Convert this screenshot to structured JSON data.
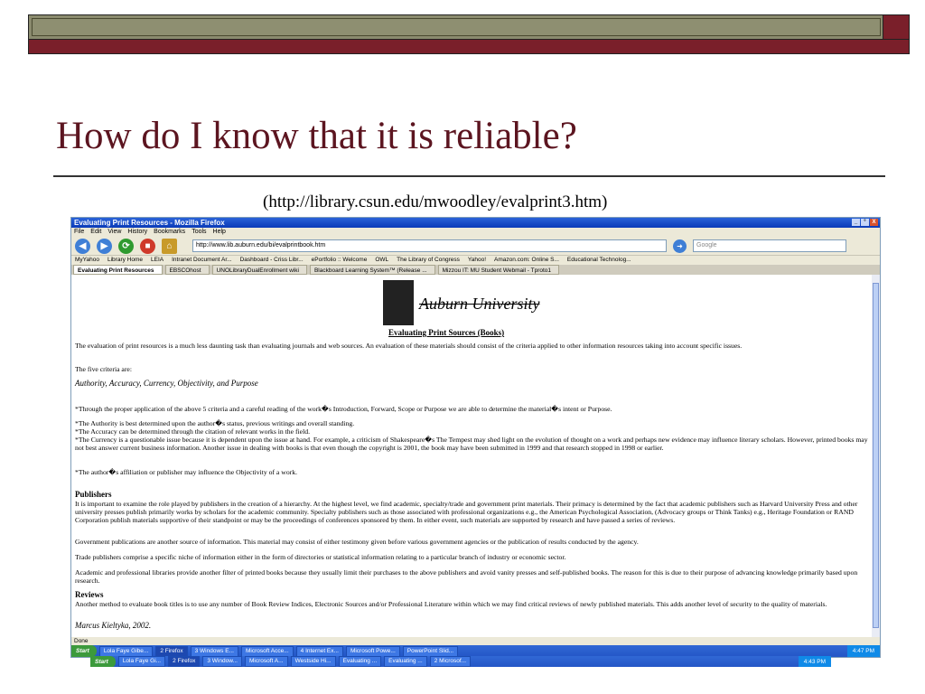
{
  "slide": {
    "title": "How do I know that it is reliable?",
    "caption": "(http://library.csun.edu/mwoodley/evalprint3.htm)",
    "accent_color": "#7a1f2a",
    "bar_color": "#8b8b6e"
  },
  "window": {
    "title": "Evaluating Print Resources - Mozilla Firefox",
    "controls": [
      "_",
      "°",
      "X"
    ]
  },
  "menu": [
    "File",
    "Edit",
    "View",
    "History",
    "Bookmarks",
    "Tools",
    "Help"
  ],
  "nav": {
    "url": "http://www.lib.auburn.edu/bi/evalprintbook.htm",
    "search_placeholder": "Google"
  },
  "bookmarks": [
    "MyYahoo",
    "Library Home",
    "LEIA",
    "Intranet Document Ar...",
    "Dashboard - Criss Libr...",
    "ePortfolio :: Welcome",
    "OWL",
    "The Library of Congress",
    "Yahoo!",
    "Amazon.com: Online S...",
    "Educational Technolog..."
  ],
  "tabs": [
    "Evaluating Print Resources",
    "EBSCOhost",
    "UNOLibraryDualEnrollment wiki",
    "Blackboard Learning System™ (Release ...",
    "Mizzou IT: MU Student Webmail - Tproto1"
  ],
  "page": {
    "logo_text": "Auburn University",
    "heading": "Evaluating Print Sources (Books)",
    "p1": "The evaluation of print resources is a much less daunting task than evaluating journals and web sources. An evaluation of these materials should consist of the criteria applied to other information resources taking into account specific issues.",
    "p2": "The five criteria are:",
    "criteria": "Authority, Accuracy, Currency, Objectivity, and Purpose",
    "p3": "*Through the proper application of the above 5 criteria and a careful reading of the work�s Introduction, Forward, Scope or Purpose we are able to determine the material�s intent or Purpose.",
    "p4": "*The Authority is best determined upon the author�s status, previous writings and overall standing.",
    "p5": "*The Accuracy can be determined through the citation of relevant works in the field.",
    "p6": "*The Currency is a questionable issue because it is dependent upon the issue at hand. For example, a criticism of Shakespeare�s The Tempest may shed light on the evolution of thought on a work and perhaps new evidence may influence literary scholars. However, printed books may not best answer current business information. Another issue in dealing with books is that even though the copyright is 2001, the book may have been submitted in 1999 and that research stopped in 1998 or earlier.",
    "p7": "*The author�s affiliation or publisher may influence the Objectivity of a work.",
    "h_publishers": "Publishers",
    "p8": "It is important to examine the role played by publishers in the creation of a hierarchy. At the highest level, we find academic, specialty/trade and government print materials. Their primacy is determined by the fact that academic publishers such as Harvard University Press and other university presses publish primarily works by scholars for the academic community. Specialty publishers such as those associated with professional organizations e.g., the American Psychological Association, (Advocacy groups or Think Tanks) e.g., Heritage Foundation or RAND Corporation publish materials supportive of their standpoint or may be the proceedings of conferences sponsored by them. In either event, such materials are supported by research and have passed a series of reviews.",
    "p9": "Government publications are another source of information. This material may consist of either testimony given before various government agencies or the publication of results conducted by the agency.",
    "p10": "Trade publishers comprise a specific niche of information either in the form of directories or statistical information relating to a particular branch of industry or economic sector.",
    "p11": "Academic and professional libraries provide another filter of printed books because they usually limit their purchases to the above publishers and avoid vanity presses and self-published books. The reason for this is due to their purpose of advancing knowledge primarily based upon research.",
    "h_reviews": "Reviews",
    "p12": "Another method to evaluate book titles is to use any number of Book Review Indices, Electronic Sources and/or Professional Literature within which we may find critical reviews of newly published materials. This adds another level of security to the quality of materials.",
    "signature": "Marcus Kieltyka, 2002."
  },
  "status": "Done",
  "taskbar": {
    "start": "Start",
    "items": [
      "Lola Faye Gibe...",
      "2 Firefox",
      "3 Windows E...",
      "Microsoft Acce...",
      "4 Internet Ex...",
      "Microsoft Powe...",
      "PowerPoint Slid..."
    ],
    "active_index": 1,
    "clock": "4:47 PM"
  },
  "taskbar2": {
    "start": "Start",
    "items": [
      "Lola Faye Gi...",
      "2 Firefox",
      "3 Window...",
      "Microsoft A...",
      "Westside Hi...",
      "Evaluating ...",
      "Evaluating ...",
      "2 Microsof..."
    ],
    "active_index": 1,
    "clock": "4:43 PM"
  }
}
